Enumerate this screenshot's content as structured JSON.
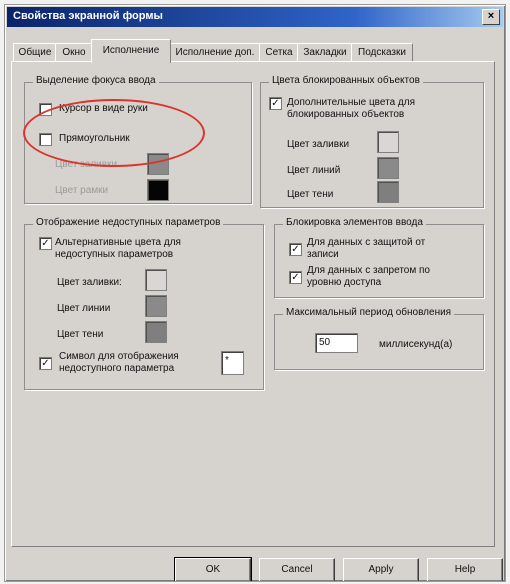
{
  "window": {
    "title": "Свойства экранной формы",
    "close_glyph": "×"
  },
  "tabs": [
    {
      "label": "Общие"
    },
    {
      "label": "Окно"
    },
    {
      "label": "Исполнение"
    },
    {
      "label": "Исполнение доп."
    },
    {
      "label": "Сетка"
    },
    {
      "label": "Закладки"
    },
    {
      "label": "Подсказки"
    }
  ],
  "focus_group": {
    "title": "Выделение фокуса ввода",
    "cursor_hand": {
      "label": "Курсор в виде руки",
      "checked": false
    },
    "rectangle": {
      "label": "Прямоугольник",
      "checked": false
    },
    "fill_color_label": "Цвет заливки",
    "frame_color_label": "Цвет рамки"
  },
  "blocked_group": {
    "title": "Цвета блокированных объектов",
    "extra_colors": {
      "label_line1": "Дополнительные цвета для",
      "label_line2": "блокированных объектов",
      "checked": true
    },
    "fill_label": "Цвет заливки",
    "line_label": "Цвет линий",
    "shadow_label": "Цвет тени"
  },
  "unavailable_group": {
    "title": "Отображение недоступных параметров",
    "alt_colors": {
      "label_line1": "Альтернативные цвета для",
      "label_line2": "недоступных параметров",
      "checked": true
    },
    "fill_label": "Цвет заливки:",
    "line_label": "Цвет линии",
    "shadow_label": "Цвет тени",
    "symbol": {
      "label_line1": "Символ для отображения",
      "label_line2": "недоступного параметра",
      "checked": true,
      "value": "*"
    }
  },
  "input_block_group": {
    "title": "Блокировка элементов ввода",
    "protected": {
      "label_line1": "Для данных с защитой от",
      "label_line2": "записи",
      "checked": true
    },
    "forbidden": {
      "label_line1": "Для данных с запретом по",
      "label_line2": "уровню доступа",
      "checked": true
    }
  },
  "refresh_group": {
    "title": "Максимальный период обновления",
    "value": "50",
    "unit": "миллисекунд(а)"
  },
  "buttons": {
    "ok": "OK",
    "cancel": "Cancel",
    "apply": "Apply",
    "help": "Help"
  },
  "colors": {
    "swatch_light": "#d9d6d3",
    "swatch_gray": "#8a8a8a",
    "swatch_gray2": "#7f7f7f",
    "swatch_black": "#050505",
    "annotation": "#d9352c"
  },
  "check_glyph": "✓"
}
